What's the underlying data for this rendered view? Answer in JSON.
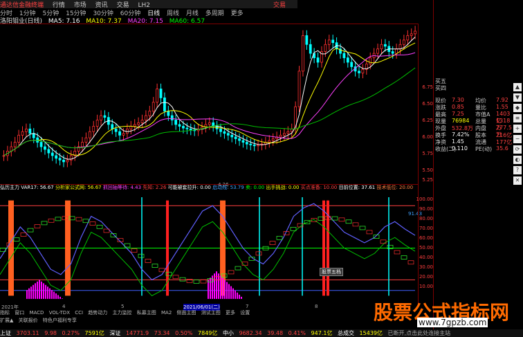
{
  "titlebar": {
    "items": [
      "通达信金融终端",
      "行情",
      "市场",
      "资讯",
      "交易",
      "LH2",
      "交易"
    ]
  },
  "periods": [
    "分时",
    "1分钟",
    "5分钟",
    "15分钟",
    "30分钟",
    "60分钟",
    "日线",
    "周线",
    "月线",
    "多周期",
    "更多"
  ],
  "ma_line": {
    "name": "洛阳钼业(日线)",
    "ma5": "MA5: 7.16",
    "ma10": "MA10: 7.37",
    "ma20": "MA20: 7.15",
    "ma60": "MA60: 6.57"
  },
  "indicator_line": {
    "name": "弘历主力",
    "var": "VAR17: 56.67",
    "f1": "分析家公式网: 56.67",
    "f2": "抓回抽等待: 4.43",
    "f3": "先知: 2.26",
    "f4": "可能被套拉升: 0.00",
    "f5": "启动线: 53.79",
    "f6": "卖: 0.00",
    "f7": "出手挑战: 0.00",
    "f8": "买点准备: 10.00",
    "f9": "目前位置: 37.61",
    "f10": "技术低位: 20.00"
  },
  "price_axis": [
    "6.75",
    "6.50",
    "6.25",
    "6.00",
    "5.75",
    "5.50",
    "5.25"
  ],
  "ind_axis": [
    "100.00",
    "90.00",
    "80.00",
    "70.00",
    "60.00",
    "50.00",
    "40.00",
    "30.00",
    "20.00",
    "10.00"
  ],
  "date_labels": [
    "2021年",
    "4",
    "5",
    "2021/06/01(二)",
    "7",
    "8"
  ],
  "tabs": [
    "指标",
    "窗口",
    "MACD",
    "VOL-TDX",
    "CCI",
    "趋势动力",
    "主力监控",
    "私募主图",
    "MA2",
    "侧面主图",
    "测试主图",
    "更多",
    "设置"
  ],
  "tabs2": [
    "扩展▲",
    "关联报价",
    "特色户福利专享"
  ],
  "quote": {
    "top": [
      "买五",
      "买四"
    ],
    "rows": [
      {
        "k": "现价",
        "v": "7.30",
        "k2": "均价",
        "v2": "7.92"
      },
      {
        "k": "涨跌",
        "v": "0.85",
        "k2": "量比",
        "v2": "1.55"
      },
      {
        "k": "最高",
        "v": "7.25",
        "k2": "市值A",
        "v2": "1403亿"
      },
      {
        "k": "现量",
        "v": "76984",
        "k2": "总量",
        "v2": "1318万"
      },
      {
        "k": "外盘",
        "v": "532.8万",
        "k2": "内盘",
        "v2": "277.5万"
      },
      {
        "k": "换手",
        "v": "7.42%",
        "k2": "股本",
        "v2": "216亿"
      },
      {
        "k": "净资",
        "v": "1.45",
        "k2": "流通",
        "v2": "177亿"
      },
      {
        "k": "收益(二)",
        "v": "0.110",
        "k2": "PE(动)",
        "v2": "35.6"
      }
    ]
  },
  "status": [
    "上证",
    "3703.11",
    "9.98",
    "0.27%",
    "7591亿",
    "深证",
    "14771.9",
    "73.34",
    "0.50%",
    "7849亿",
    "中小",
    "9682.34",
    "39.48",
    "0.41%",
    "947.1亿",
    "总成交",
    "15439亿",
    "已断开,点击此处连接主站"
  ],
  "watermark": "股票公式指标网",
  "watermark_url": "www.7gpzb.com",
  "popup_label": "股票五档",
  "kpane_marker": "4.26",
  "value_label": "91.43",
  "vtoolbar": [
    "▲",
    "▼",
    "◆",
    "≡",
    "+",
    "−",
    "⟳",
    "◐",
    "?",
    "✕"
  ],
  "chart_data": {
    "type": "candlestick",
    "price_range": [
      5.2,
      6.85
    ],
    "indicator_range": [
      0,
      100
    ],
    "closes": [
      5.45,
      5.5,
      5.55,
      5.6,
      5.68,
      5.72,
      5.75,
      5.7,
      5.65,
      5.6,
      5.55,
      5.52,
      5.48,
      5.45,
      5.42,
      5.4,
      5.38,
      5.4,
      5.45,
      5.5,
      5.55,
      5.6,
      5.65,
      5.72,
      5.78,
      5.85,
      5.9,
      5.88,
      5.8,
      5.75,
      5.72,
      5.68,
      5.7,
      5.75,
      5.78,
      5.8,
      5.82,
      5.85,
      5.9,
      5.95,
      6.05,
      6.2,
      6.1,
      5.95,
      5.9,
      5.85,
      5.8,
      5.78,
      5.76,
      5.75,
      5.74,
      5.73,
      5.75,
      5.77,
      5.8,
      5.82,
      5.78,
      5.75,
      5.72,
      5.7,
      5.68,
      5.66,
      5.64,
      5.62,
      5.6,
      5.58,
      5.57,
      5.56,
      5.57,
      5.58,
      5.6,
      5.62,
      5.64,
      5.66,
      5.68,
      5.7,
      5.72,
      5.75,
      6.0,
      6.4,
      6.8,
      6.7,
      6.6,
      6.55,
      6.5,
      6.62,
      6.7,
      6.75,
      6.72,
      6.65,
      6.6,
      6.55,
      6.5,
      6.45,
      6.4,
      6.38,
      6.42,
      6.48,
      6.55,
      6.6,
      6.65,
      6.7,
      6.68,
      6.62,
      6.6,
      6.65,
      6.7,
      6.75,
      6.8,
      6.82,
      6.85
    ]
  }
}
